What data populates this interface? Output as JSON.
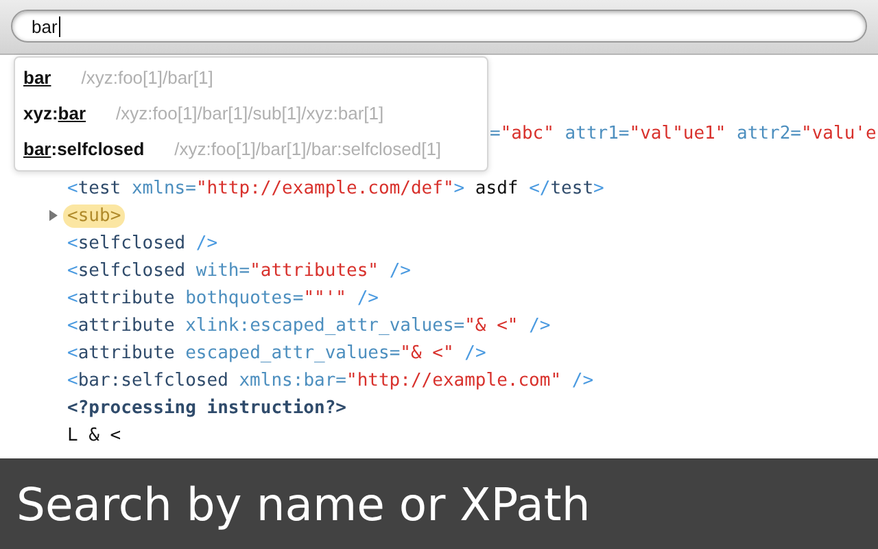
{
  "search": {
    "value": "bar"
  },
  "suggestions": [
    {
      "name": [
        {
          "text": "bar",
          "match": true
        }
      ],
      "path": "/xyz:foo[1]/bar[1]"
    },
    {
      "name": [
        {
          "text": "xyz:",
          "match": false
        },
        {
          "text": "bar",
          "match": true
        }
      ],
      "path": "/xyz:foo[1]/bar[1]/sub[1]/xyz:bar[1]"
    },
    {
      "name": [
        {
          "text": "bar",
          "match": true
        },
        {
          "text": ":selfclosed",
          "match": false
        }
      ],
      "path": "/xyz:foo[1]/bar[1]/bar:selfclosed[1]"
    }
  ],
  "tree": [
    {
      "highlighted": false,
      "tokens": [
        {
          "kind": "attr",
          "text": "="
        },
        {
          "kind": "value",
          "text": "\"abc\""
        },
        {
          "kind": "attr",
          "text": " attr1="
        },
        {
          "kind": "value",
          "text": "\"val\"ue1\""
        },
        {
          "kind": "attr",
          "text": " attr2="
        },
        {
          "kind": "value",
          "text": "\"valu'e"
        }
      ],
      "children": [
        {
          "highlighted": false,
          "tokens": [
            {
              "kind": "punct",
              "text": "<"
            },
            {
              "kind": "name",
              "text": "test"
            },
            {
              "kind": "attr",
              "text": " xmlns="
            },
            {
              "kind": "value",
              "text": "\"http://example.com/def\""
            },
            {
              "kind": "punct",
              "text": ">"
            },
            {
              "kind": "text",
              "text": " asdf "
            },
            {
              "kind": "punct",
              "text": "</"
            },
            {
              "kind": "name",
              "text": "test"
            },
            {
              "kind": "punct",
              "text": ">"
            }
          ]
        },
        {
          "highlighted": true,
          "expanded": false,
          "tokens": [
            {
              "kind": "punct",
              "text": "<"
            },
            {
              "kind": "name",
              "text": "sub"
            },
            {
              "kind": "punct",
              "text": ">"
            }
          ]
        },
        {
          "highlighted": false,
          "tokens": [
            {
              "kind": "punct",
              "text": "<"
            },
            {
              "kind": "name",
              "text": "selfclosed"
            },
            {
              "kind": "punct",
              "text": " />"
            }
          ]
        },
        {
          "highlighted": false,
          "tokens": [
            {
              "kind": "punct",
              "text": "<"
            },
            {
              "kind": "name",
              "text": "selfclosed"
            },
            {
              "kind": "attr",
              "text": " with="
            },
            {
              "kind": "value",
              "text": "\"attributes\""
            },
            {
              "kind": "punct",
              "text": " />"
            }
          ]
        },
        {
          "highlighted": false,
          "tokens": [
            {
              "kind": "punct",
              "text": "<"
            },
            {
              "kind": "name",
              "text": "attribute"
            },
            {
              "kind": "attr",
              "text": " bothquotes="
            },
            {
              "kind": "value",
              "text": "\"\"'\""
            },
            {
              "kind": "punct",
              "text": " />"
            }
          ]
        },
        {
          "highlighted": false,
          "tokens": [
            {
              "kind": "punct",
              "text": "<"
            },
            {
              "kind": "name",
              "text": "attribute"
            },
            {
              "kind": "attr",
              "text": " xlink:escaped_attr_values="
            },
            {
              "kind": "value",
              "text": "\"& <\""
            },
            {
              "kind": "punct",
              "text": " />"
            }
          ]
        },
        {
          "highlighted": false,
          "tokens": [
            {
              "kind": "punct",
              "text": "<"
            },
            {
              "kind": "name",
              "text": "attribute"
            },
            {
              "kind": "attr",
              "text": " escaped_attr_values="
            },
            {
              "kind": "value",
              "text": "\"& <\""
            },
            {
              "kind": "punct",
              "text": " />"
            }
          ]
        },
        {
          "highlighted": false,
          "tokens": [
            {
              "kind": "punct",
              "text": "<"
            },
            {
              "kind": "name",
              "text": "bar:selfclosed"
            },
            {
              "kind": "attr",
              "text": " xmlns:bar="
            },
            {
              "kind": "value",
              "text": "\"http://example.com\""
            },
            {
              "kind": "punct",
              "text": " />"
            }
          ]
        },
        {
          "highlighted": false,
          "tokens": [
            {
              "kind": "pi",
              "text": "<?processing instruction?>"
            }
          ]
        },
        {
          "highlighted": false,
          "tokens": [
            {
              "kind": "text",
              "text": "L & <"
            }
          ]
        }
      ]
    }
  ],
  "caption": "Search by name or XPath"
}
